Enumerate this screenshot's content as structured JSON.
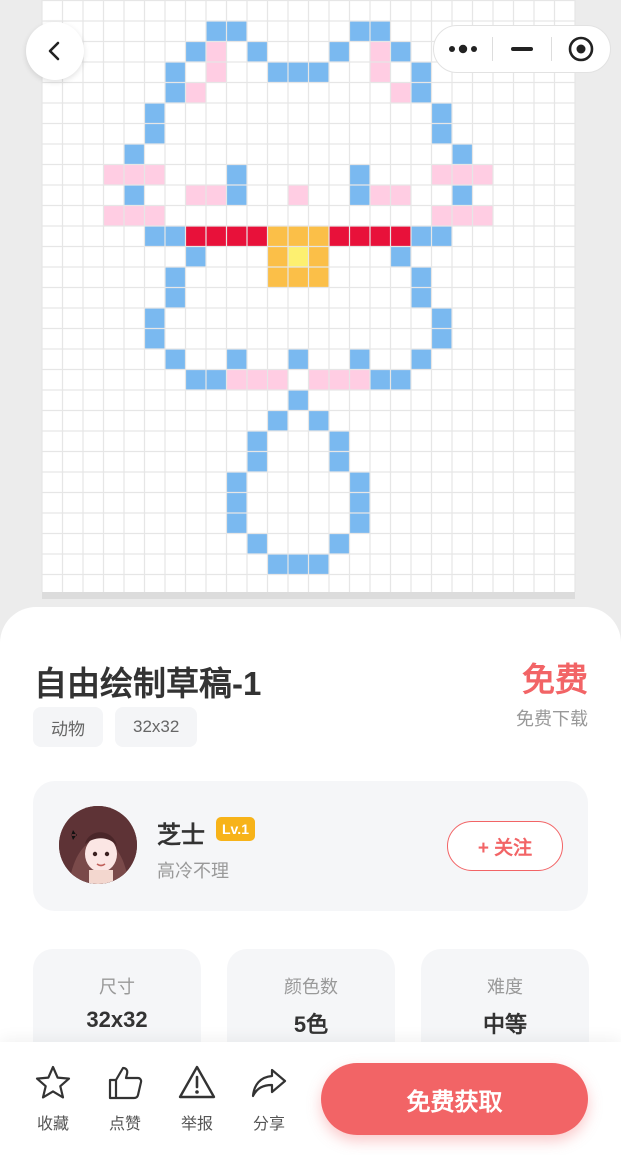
{
  "nav": {
    "back_icon": "chevron-left-icon",
    "more_icon": "more-dots-icon",
    "minimize_icon": "minus-icon",
    "close_icon": "target-icon"
  },
  "artwork": {
    "grid_size": 32,
    "colors": {
      "grid_line": "#e6e6e6",
      "blue": "#7ab9f0",
      "pink": "#ffcde3",
      "red": "#e8113a",
      "gold": "#fbbf48",
      "yellow": "#fdf070"
    }
  },
  "detail": {
    "title": "自由绘制草稿-1",
    "price": "免费",
    "price_note": "免费下载",
    "tags": [
      "动物",
      "32x32"
    ]
  },
  "author": {
    "name": "芝士",
    "level": "Lv.1",
    "bio": "高冷不理",
    "follow_label": "+ 关注"
  },
  "stats": [
    {
      "label": "尺寸",
      "value": "32x32"
    },
    {
      "label": "颜色数",
      "value": "5色"
    },
    {
      "label": "难度",
      "value": "中等"
    }
  ],
  "actions": [
    {
      "label": "收藏",
      "icon": "star-icon"
    },
    {
      "label": "点赞",
      "icon": "thumbs-up-icon"
    },
    {
      "label": "举报",
      "icon": "warning-icon"
    },
    {
      "label": "分享",
      "icon": "share-icon"
    }
  ],
  "cta": "免费获取",
  "theme": {
    "accent": "#f26466",
    "badge": "#f7b319"
  }
}
